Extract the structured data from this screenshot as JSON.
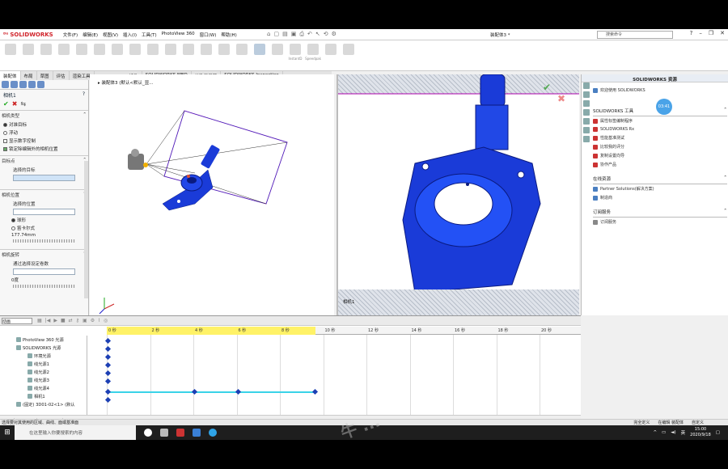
{
  "app": {
    "brand": "SOLIDWORKS",
    "doc_title": "装配体3 *",
    "search_placeholder": "搜索命令"
  },
  "menu": [
    "文件(F)",
    "编辑(E)",
    "视图(V)",
    "插入(I)",
    "工具(T)",
    "PhotoView 360",
    "窗口(W)",
    "帮助(H)"
  ],
  "ribbon_tools": [
    "",
    "",
    "",
    "",
    "",
    "",
    "",
    "",
    "",
    "",
    "",
    "",
    "",
    "",
    "",
    "",
    "InstantD",
    "Speedpak",
    "",
    ""
  ],
  "tabs": [
    "装配体",
    "布局",
    "草图",
    "评估",
    "渲染工具",
    "SOLIDWORKS 插件",
    "SOLIDWORKS MBD",
    "外购工具箱",
    "SOLIDWORKS Inspection"
  ],
  "left_panel": {
    "title": "相机1",
    "section_type": "相机类型",
    "opt_aimed": "对准目标",
    "opt_float": "浮动",
    "chk_numeric": "显示数字控制",
    "chk_lock": "锁定除编辑外的相机位置",
    "section_target": "目标点",
    "target_sub": "选择的目标",
    "section_position": "相机位置",
    "position_sub": "选择的位置",
    "opt_sphere": "球形",
    "opt_cart": "笛卡尔式",
    "distance": "177.74mm",
    "section_rotation": "相机旋转",
    "rotation_sub": "通过选择设定卷数",
    "roll": "0度"
  },
  "viewport1": {
    "tree_label": "装配体3 (默认<默认_显..."
  },
  "viewport2": {
    "label": "相机1"
  },
  "task_pane": {
    "header": "SOLIDWORKS 资源",
    "welcome": "欢迎使用 SOLIDWORKS",
    "badge": "03:41",
    "sec_tools": "SOLIDWORKS 工具",
    "tools": [
      "属性标签编制程序",
      "SOLIDWORKS Rx",
      "性能基准测试",
      "比较我的评分",
      "复制设置向导",
      "协作产品"
    ],
    "sec_community": "在线资源",
    "community": [
      "Partner Solutions(解决方案)",
      "制造商"
    ],
    "sec_subscription": "订阅服务",
    "subscription": [
      "订阅服务"
    ]
  },
  "motion": {
    "study_type": "动画",
    "rows": [
      "PhotoView 360 光源",
      "SOLIDWORKS 光源",
      "环境光源",
      "线光源1",
      "线光源2",
      "线光源3",
      "线光源4",
      "相机1",
      "(固定) 3D01-02<1> (默认"
    ],
    "ticks": [
      "0 秒",
      "2 秒",
      "4 秒",
      "6 秒",
      "8 秒",
      "10 秒",
      "12 秒",
      "14 秒",
      "16 秒",
      "18 秒",
      "20 秒"
    ],
    "bottom_tabs": [
      "模型",
      "3D 视图",
      "运动算例1"
    ]
  },
  "status": {
    "left": "选择要对其使用的区域、曲线、面或基准面",
    "center": "完全定义",
    "mid": "在编辑 装配体",
    "unit": "自定义"
  },
  "taskbar": {
    "search": "在这里输入你要搜索的内容",
    "time": "15:00",
    "date": "2020/9/18",
    "lang": "英"
  },
  "watermark": "牛 ..."
}
